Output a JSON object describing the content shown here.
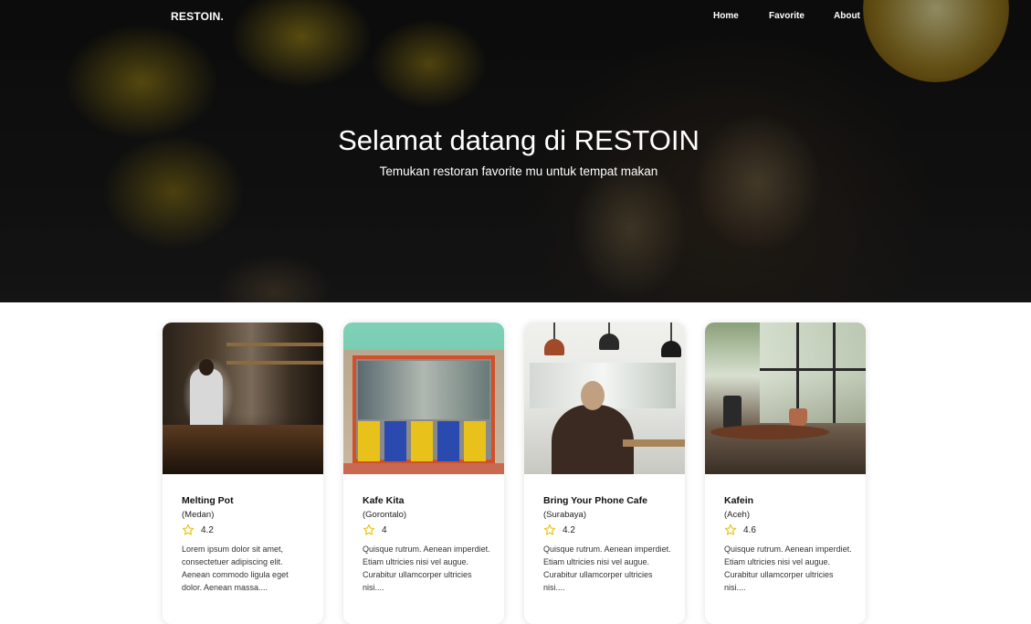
{
  "navbar": {
    "brand": "RESTOIN.",
    "links": [
      "Home",
      "Favorite",
      "About"
    ]
  },
  "hero": {
    "title": "Selamat datang di RESTOIN",
    "subtitle": "Temukan restoran favorite mu untuk tempat makan"
  },
  "restaurants": [
    {
      "name": "Melting Pot",
      "city": "(Medan)",
      "rating": "4.2",
      "description": "Lorem ipsum dolor sit amet, consectetuer adipiscing elit. Aenean commodo ligula eget dolor. Aenean massa...."
    },
    {
      "name": "Kafe Kita",
      "city": "(Gorontalo)",
      "rating": "4",
      "description": "Quisque rutrum. Aenean imperdiet. Etiam ultricies nisi vel augue. Curabitur ullamcorper ultricies nisi...."
    },
    {
      "name": "Bring Your Phone Cafe",
      "city": "(Surabaya)",
      "rating": "4.2",
      "description": "Quisque rutrum. Aenean imperdiet. Etiam ultricies nisi vel augue. Curabitur ullamcorper ultricies nisi...."
    },
    {
      "name": "Kafein",
      "city": "(Aceh)",
      "rating": "4.6",
      "description": "Quisque rutrum. Aenean imperdiet. Etiam ultricies nisi vel augue. Curabitur ullamcorper ultricies nisi...."
    }
  ],
  "icons": {
    "star": "star-outline-icon"
  },
  "colors": {
    "star": "#e8c21a",
    "hero_text": "#ffffff",
    "card_background": "#ffffff"
  }
}
